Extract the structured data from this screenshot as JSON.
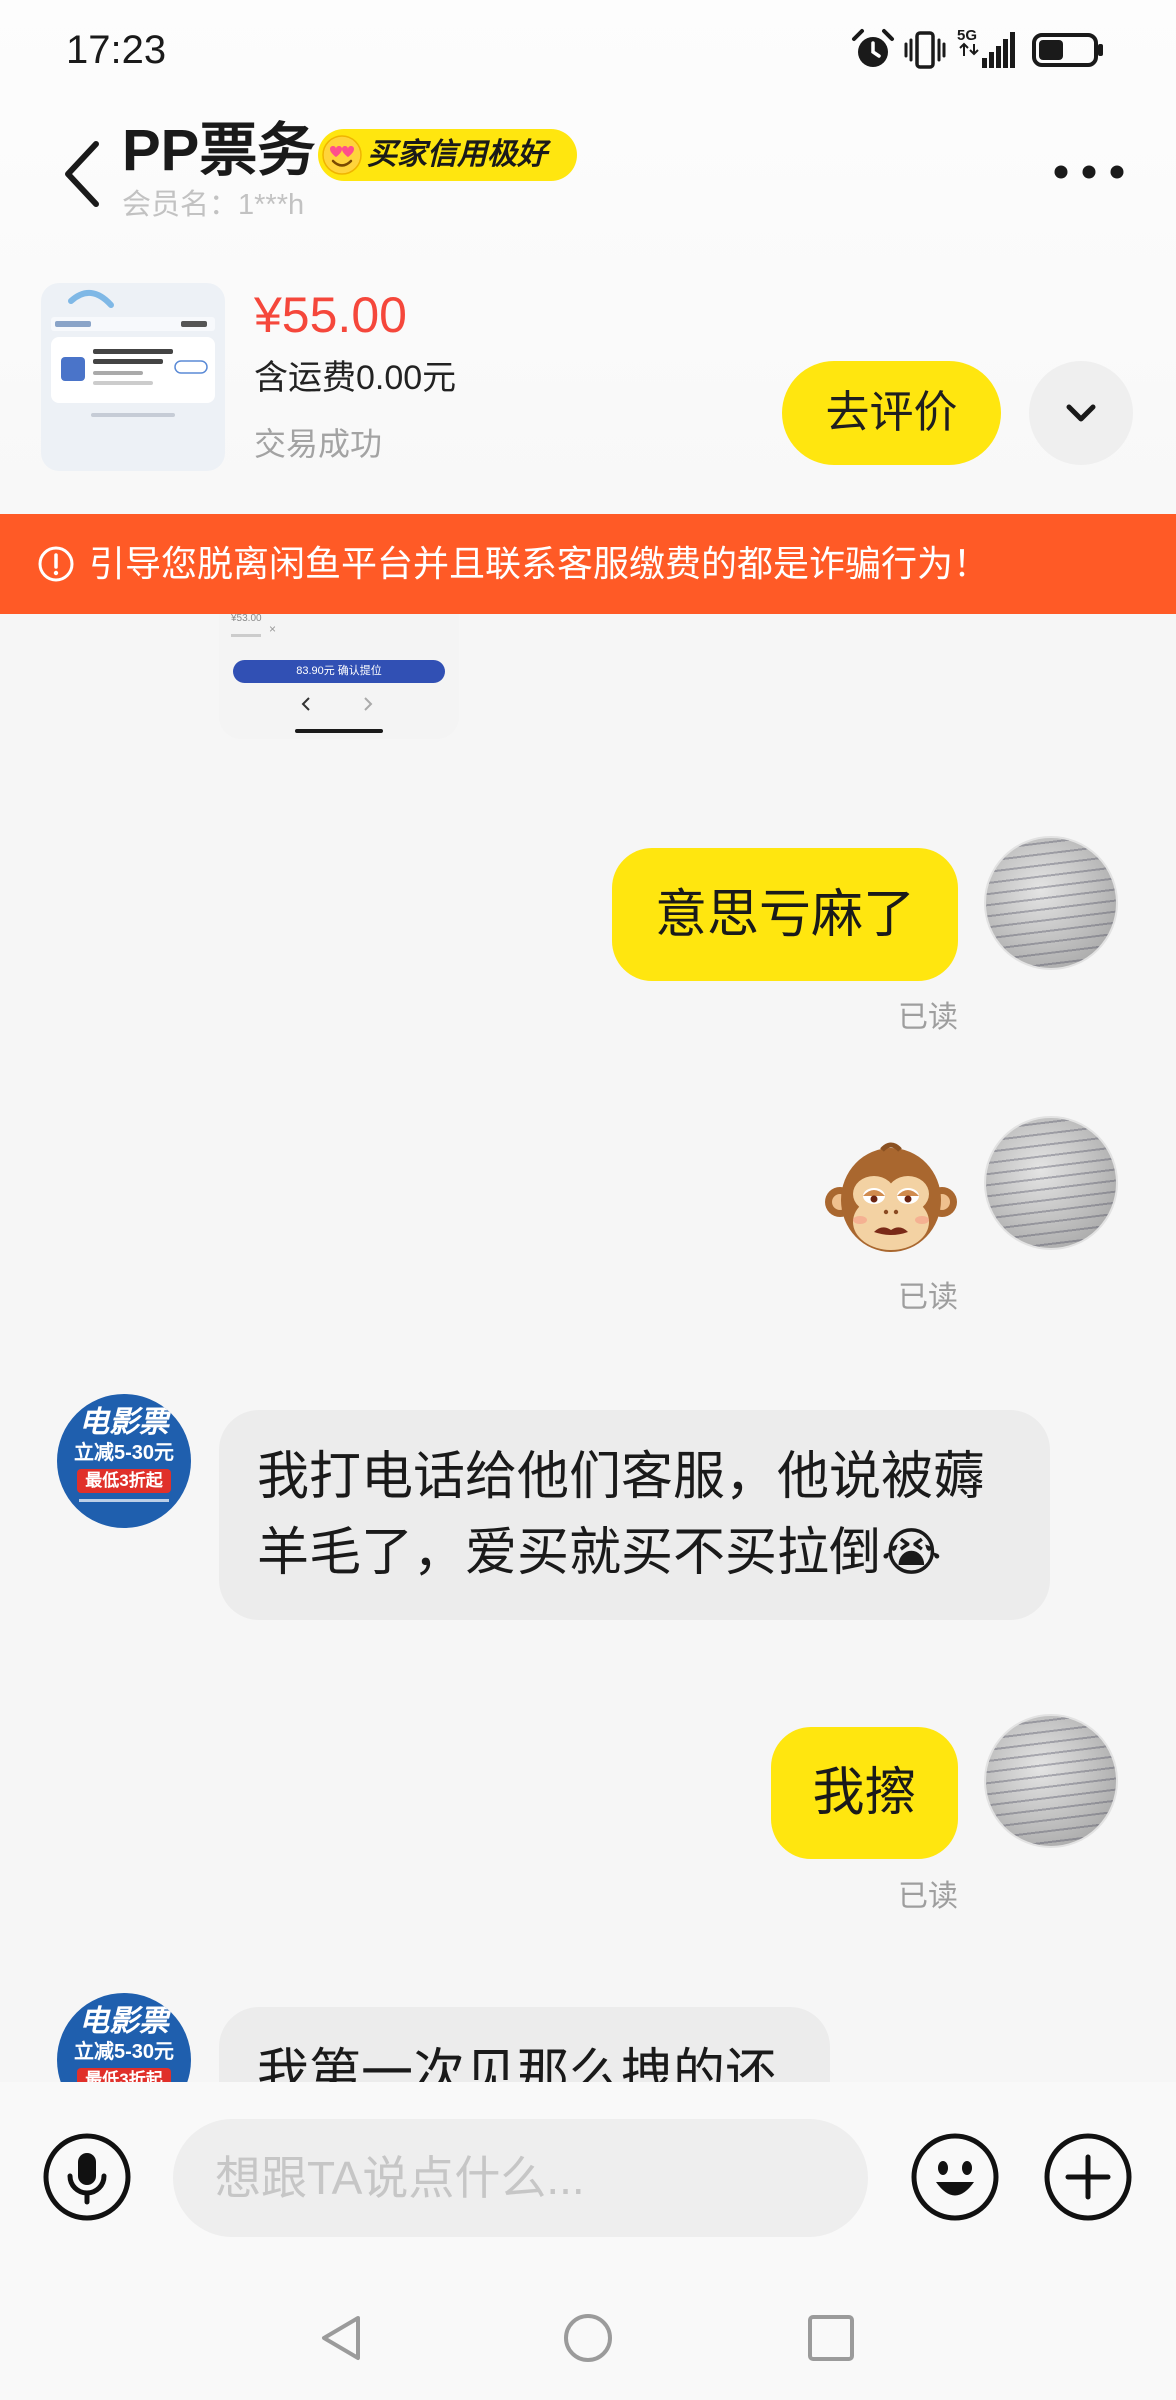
{
  "status_bar": {
    "time": "17:23",
    "network": "5G",
    "battery_level": 0.45,
    "icons": [
      "alarm-icon",
      "vibrate-icon",
      "signal-icon",
      "battery-icon"
    ]
  },
  "header": {
    "back_icon": "chevron-left-icon",
    "title": "PP票务",
    "badge_icon": "heart-eyes-emoji-icon",
    "badge": "买家信用极好",
    "subtitle": "会员名：1***h",
    "more_icon": "more-dots-icon"
  },
  "product": {
    "price": "¥55.00",
    "shipping": "含运费0.00元",
    "status": "交易成功",
    "review_button": "去评价",
    "expand_icon": "chevron-down-icon"
  },
  "banner": {
    "icon": "info-circle-icon",
    "text": "引导您脱离闲鱼平台并且联系客服缴费的都是诈骗行为！"
  },
  "shared_image": {
    "price": "¥53.00",
    "confirm_button": "83.90元 确认提位"
  },
  "seller_avatar": {
    "line1": "电影票",
    "line2": "立减5-30元",
    "line3": "最低3折起"
  },
  "messages": [
    {
      "side": "right",
      "type": "text",
      "text": "意思亏麻了",
      "status": "已读"
    },
    {
      "side": "right",
      "type": "sticker",
      "sticker": "monkey-sticker",
      "status": "已读"
    },
    {
      "side": "left",
      "type": "text",
      "text": "我打电话给他们客服，他说被薅羊毛了，爱买就买不买拉倒😭"
    },
    {
      "side": "right",
      "type": "text",
      "text": "我擦",
      "status": "已读"
    },
    {
      "side": "left",
      "type": "text",
      "text": "我第一次见那么拽的还"
    }
  ],
  "composer": {
    "placeholder": "想跟TA说点什么...",
    "icons": [
      "microphone-icon",
      "emoji-icon",
      "plus-icon"
    ]
  },
  "nav_bar": {
    "icons": [
      "back-nav-icon",
      "home-nav-icon",
      "recents-nav-icon"
    ]
  },
  "colors": {
    "brand_yellow": "#ffe60f",
    "banner": "#ff5a26",
    "price": "#f5473b",
    "bubble_left": "#ececec"
  }
}
